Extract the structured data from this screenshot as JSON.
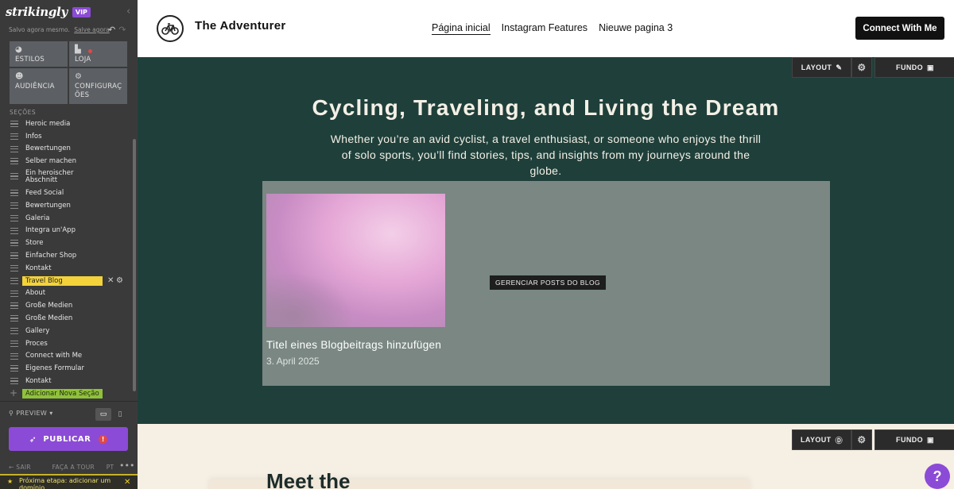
{
  "editor": {
    "logo": "strikingly",
    "vip_badge": "VIP",
    "collapse_icon": "chevron-left-icon",
    "save_status": "Salvo agora mesmo.",
    "save_link": "Salve agora",
    "tools": [
      {
        "label": "ESTILOS",
        "icon": "palette-icon"
      },
      {
        "label": "LOJA",
        "icon": "shopping-bag-icon"
      },
      {
        "label": "AUDIÊNCIA",
        "icon": "people-icon"
      },
      {
        "label": "CONFIGURAÇ ÕES",
        "icon": "gear-icon"
      }
    ],
    "sections_title": "SEÇÕES",
    "sections": [
      "Heroic media",
      "Infos",
      "Bewertungen",
      "Selber machen",
      "Ein heroischer Abschnitt",
      "Feed Social",
      "Bewertungen",
      "Galeria",
      "Integra un'App",
      "Store",
      "Einfacher Shop",
      "Kontakt",
      "Travel Blog",
      "About",
      "Große Medien",
      "Große Medien",
      "Gallery",
      "Proces",
      "Connect with Me",
      "Eigenes Formular",
      "Kontakt"
    ],
    "active_section": "Travel Blog",
    "add_section": "Adicionar Nova Seção",
    "preview": "PREVIEW",
    "publish": "PUBLICAR",
    "bottom_links": [
      "SAIR",
      "FAÇA A TOUR",
      "PT"
    ],
    "next_step": "Próxima etapa: adicionar um domínio"
  },
  "site": {
    "brand": "The Adventurer",
    "brand_icon": "bicycle-icon",
    "nav": [
      "Página inicial",
      "Instagram Features",
      "Nieuwe pagina 3"
    ],
    "cta": "Connect With Me",
    "edit_layout": "LAYOUT",
    "edit_fundo": "FUNDO",
    "hero_title": "Cycling, Traveling, and Living the Dream",
    "hero_subtitle": "Whether you’re an avid cyclist, a travel enthusiast, or someone who enjoys the thrill of solo sports, you’ll find stories, tips, and insights from my journeys around the globe.",
    "blog_manage": "GERENCIAR POSTS DO BLOG",
    "blog_post_title": "Titel eines Blogbeitrags hinzufügen",
    "blog_post_date": "3. April 2025",
    "section2_title": "Meet the",
    "help": "?"
  },
  "colors": {
    "sidebar_bg": "#3a3a3a",
    "accent_purple": "#8b4bd6",
    "active_yellow": "#f3d23c",
    "add_green": "#8fc13b",
    "hero_bg": "#1f3f3a",
    "section2_bg": "#f6efe3"
  }
}
